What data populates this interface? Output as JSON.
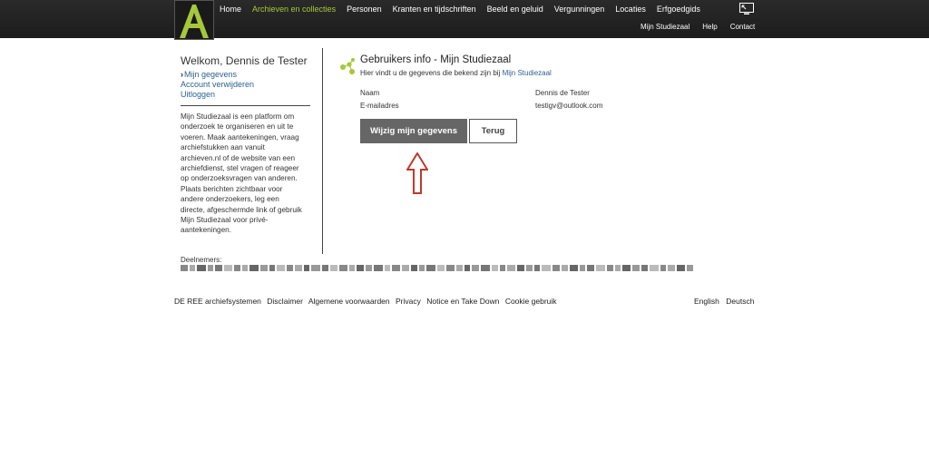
{
  "header": {
    "logo_letter": "A",
    "nav": [
      {
        "label": "Home",
        "active": false
      },
      {
        "label": "Archieven en collecties",
        "active": true
      },
      {
        "label": "Personen",
        "active": false
      },
      {
        "label": "Kranten en tijdschriften",
        "active": false
      },
      {
        "label": "Beeld en geluid",
        "active": false
      },
      {
        "label": "Vergunningen",
        "active": false
      },
      {
        "label": "Locaties",
        "active": false
      },
      {
        "label": "Erfgoedgids",
        "active": false
      }
    ],
    "subnav": [
      "Mijn Studiezaal",
      "Help",
      "Contact"
    ],
    "accent_color": "#a6c83a"
  },
  "sidebar": {
    "welcome": "Welkom, Dennis de Tester",
    "links": [
      {
        "label": "Mijn gegevens",
        "current": true
      },
      {
        "label": "Account verwijderen",
        "current": false
      },
      {
        "label": "Uitloggen",
        "current": false
      }
    ],
    "description": [
      "Mijn Studiezaal is een platform om",
      "onderzoek te organiseren en uit te",
      "voeren. Maak aantekeningen, vraag",
      "archiefstukken aan vanuit",
      "archieven.nl of de website van een",
      "archiefdienst, stel vragen of reageer",
      "op onderzoeksvragen van anderen.",
      "Plaats berichten zichtbaar voor",
      "andere onderzoekers, leg een",
      "directe, afgeschermde link of gebruik",
      "Mijn Studiezaal voor privé-",
      "aantekeningen."
    ]
  },
  "main": {
    "title": "Gebruikers info - Mijn Studiezaal",
    "subtitle_prefix": "Hier vindt u de gegevens die bekend zijn bij",
    "subtitle_link": "Mijn Studiezaal",
    "fields": [
      {
        "label": "Naam",
        "value": "Dennis de Tester"
      },
      {
        "label": "E-mailadres",
        "value": "testigv@outlook.com"
      }
    ],
    "edit_button": "Wijzig mijn gegevens",
    "back_button": "Terug",
    "annotation_color": "#c0392b"
  },
  "participants": {
    "label": "Deelnemers:"
  },
  "footer": {
    "links": [
      "DE REE archiefsystemen",
      "Disclaimer",
      "Algemene voorwaarden",
      "Privacy",
      "Notice en Take Down",
      "Cookie gebruik"
    ],
    "languages": [
      "English",
      "Deutsch"
    ]
  }
}
